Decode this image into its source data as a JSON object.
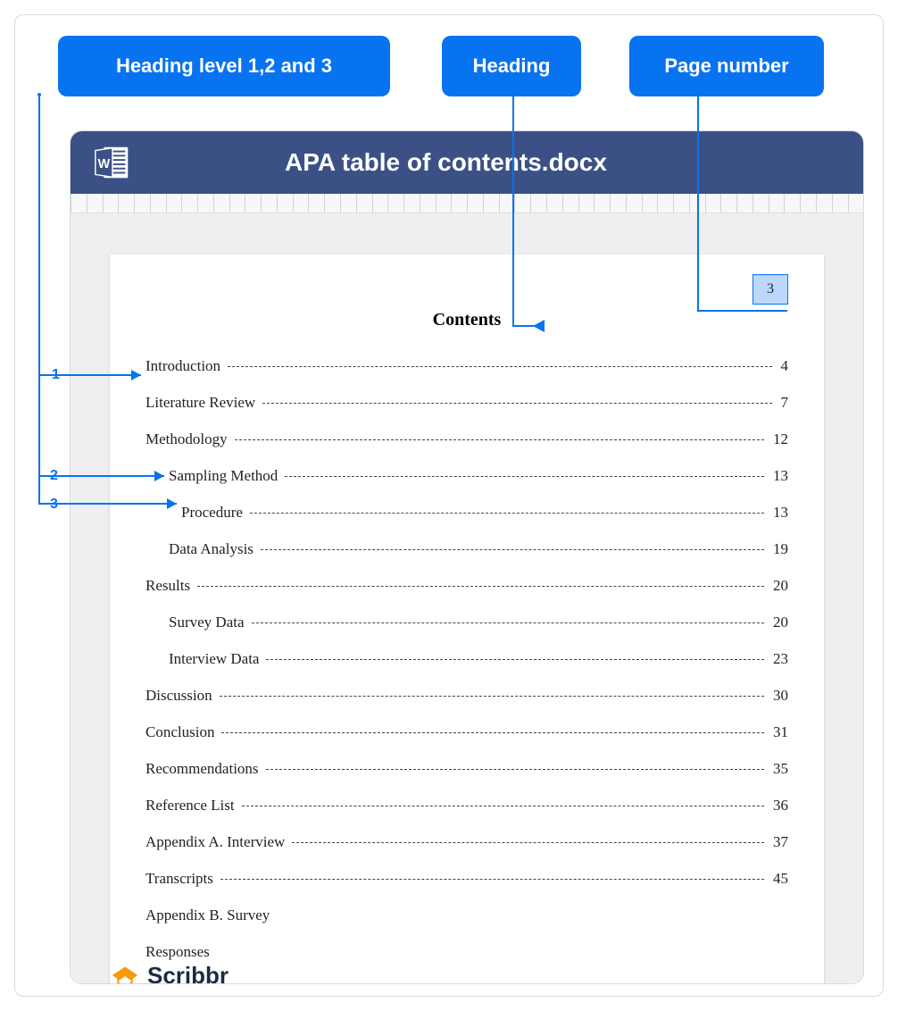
{
  "labels": {
    "heading_levels": "Heading level 1,2 and 3",
    "heading": "Heading",
    "page_number": "Page number"
  },
  "document": {
    "title": "APA table of contents.docx",
    "page_number": "3",
    "toc_title": "Contents"
  },
  "level_markers": {
    "l1": "1",
    "l2": "2",
    "l3": "3"
  },
  "toc": [
    {
      "label": "Introduction",
      "page": "4",
      "level": 1
    },
    {
      "label": "Literature Review",
      "page": "7",
      "level": 1
    },
    {
      "label": "Methodology",
      "page": "12",
      "level": 1
    },
    {
      "label": "Sampling Method",
      "page": "13",
      "level": 2
    },
    {
      "label": "Procedure",
      "page": "13",
      "level": 3
    },
    {
      "label": "Data Analysis",
      "page": "19",
      "level": 2
    },
    {
      "label": "Results",
      "page": "20",
      "level": 1
    },
    {
      "label": "Survey Data",
      "page": "20",
      "level": 2
    },
    {
      "label": "Interview Data",
      "page": "23",
      "level": 2
    },
    {
      "label": "Discussion",
      "page": "30",
      "level": 1
    },
    {
      "label": "Conclusion",
      "page": "31",
      "level": 1
    },
    {
      "label": "Recommendations",
      "page": "35",
      "level": 1
    },
    {
      "label": "Reference List",
      "page": "36",
      "level": 1
    },
    {
      "label": "Appendix A. Interview",
      "page": "37",
      "level": 1
    },
    {
      "label": "Transcripts",
      "page": "45",
      "level": 1
    },
    {
      "label": "Appendix B. Survey",
      "page": "",
      "level": 1,
      "nodots": true
    },
    {
      "label": "Responses",
      "page": "",
      "level": 1,
      "nodots": true
    }
  ],
  "brand": {
    "name": "Scribbr"
  }
}
